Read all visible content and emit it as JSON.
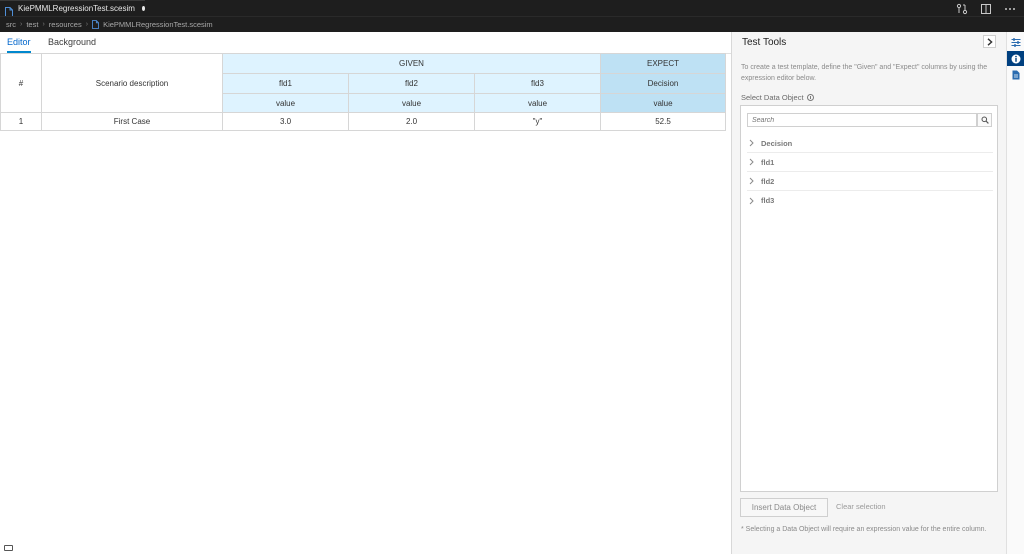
{
  "window": {
    "tab_title": "KiePMMLRegressionTest.scesim"
  },
  "breadcrumb": [
    "src",
    "test",
    "resources",
    "KiePMMLRegressionTest.scesim"
  ],
  "editor": {
    "tabs": [
      "Editor",
      "Background"
    ],
    "grid": {
      "index_header": "#",
      "description_header": "Scenario description",
      "given_group": "GIVEN",
      "expect_group": "EXPECT",
      "given_columns": [
        {
          "instance": "fld1",
          "property": "value"
        },
        {
          "instance": "fld2",
          "property": "value"
        },
        {
          "instance": "fld3",
          "property": "value"
        }
      ],
      "expect_columns": [
        {
          "instance": "Decision",
          "property": "value"
        }
      ],
      "rows": [
        {
          "index": "1",
          "description": "First Case",
          "values": [
            "3.0",
            "2.0",
            "\"y\"",
            "52.5"
          ]
        }
      ]
    }
  },
  "panel": {
    "title": "Test Tools",
    "help_text": "To create a test template, define the \"Given\" and \"Expect\" columns by using the expression editor below.",
    "select_label": "Select Data Object",
    "search_placeholder": "Search",
    "tree_items": [
      "Decision",
      "fld1",
      "fld2",
      "fld3"
    ],
    "insert_button": "Insert Data Object",
    "clear_button": "Clear selection",
    "footnote": "* Selecting a Data Object will require an expression value for the entire column."
  },
  "colors": {
    "given_header_bg": "#def3ff",
    "expect_header_bg": "#bee1f4",
    "active_tab": "#0066cc",
    "activity_active": "#004080"
  }
}
